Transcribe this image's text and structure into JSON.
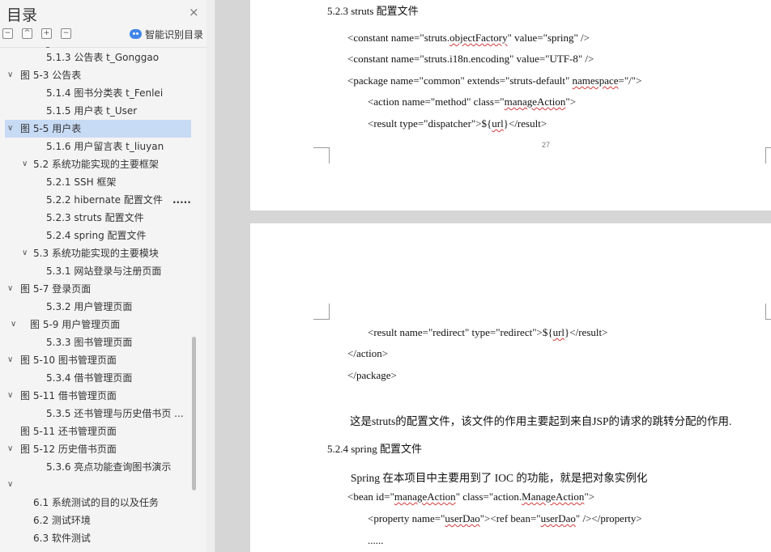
{
  "nav": {
    "title": "目录",
    "close_icon": "×",
    "toolbar": {
      "collapse_all": "−",
      "expand_all": "^",
      "expand_level": "+",
      "collapse_level": "−"
    },
    "ai_label": "智能识别目录",
    "items": [
      {
        "label": "5.1.3 公告表 t_Gonggao",
        "level": 2,
        "chevron": ""
      },
      {
        "label": "图  5-3  公告表",
        "level": 0,
        "chevron": "∨"
      },
      {
        "label": "5.1.4 图书分类表 t_Fenlei",
        "level": 2,
        "chevron": ""
      },
      {
        "label": "5.1.5 用户表 t_User",
        "level": 2,
        "chevron": ""
      },
      {
        "label": "图  5-5  用户表",
        "level": 0,
        "chevron": "∨",
        "selected": true
      },
      {
        "label": "5.1.6 用户留言表 t_liuyan",
        "level": 2,
        "chevron": ""
      },
      {
        "label": "5.2 系统功能实现的主要框架",
        "level": 1,
        "chevron": "∨"
      },
      {
        "label": "5.2.1 SSH 框架",
        "level": 2,
        "chevron": ""
      },
      {
        "label": "5.2.2 hibernate 配置文件",
        "level": 2,
        "chevron": "",
        "trail": "....."
      },
      {
        "label": "5.2.3 struts 配置文件",
        "level": 2,
        "chevron": ""
      },
      {
        "label": "5.2.4 spring 配置文件",
        "level": 2,
        "chevron": ""
      },
      {
        "label": "5.3 系统功能实现的主要模块",
        "level": 1,
        "chevron": "∨"
      },
      {
        "label": "5.3.1  网站登录与注册页面",
        "level": 2,
        "chevron": ""
      },
      {
        "label": "图  5-7  登录页面",
        "level": 0,
        "chevron": "∨"
      },
      {
        "label": "5.3.2  用户管理页面",
        "level": 2,
        "chevron": ""
      },
      {
        "label": "图 5-9  用户管理页面",
        "level": 0.6,
        "chevron": "∨"
      },
      {
        "label": "5.3.3  图书管理页面",
        "level": 2,
        "chevron": ""
      },
      {
        "label": "图 5-10  图书管理页面",
        "level": 0,
        "chevron": "∨"
      },
      {
        "label": "5.3.4 借书管理页面",
        "level": 2,
        "chevron": ""
      },
      {
        "label": "图 5-11  借书管理页面",
        "level": 0,
        "chevron": "∨"
      },
      {
        "label": "5.3.5  还书管理与历史借书页 ...",
        "level": 2,
        "chevron": ""
      },
      {
        "label": "图 5-11  还书管理页面",
        "level": 0,
        "chevron": ""
      },
      {
        "label": "图 5-12  历史借书页面",
        "level": 0,
        "chevron": "∨"
      },
      {
        "label": "5.3.6 亮点功能查询图书演示",
        "level": 2,
        "chevron": ""
      },
      {
        "label": "",
        "level": 0,
        "chevron": "∨"
      },
      {
        "label": "6.1  系统测试的目的以及任务",
        "level": 1.5,
        "chevron": ""
      },
      {
        "label": "6.2  测试环境",
        "level": 1.5,
        "chevron": ""
      },
      {
        "label": "6.3  软件测试",
        "level": 1.5,
        "chevron": ""
      }
    ]
  },
  "doc": {
    "page1": {
      "heading": "5.2.3 struts 配置文件",
      "page_number": "27",
      "lines": [
        [
          {
            "t": "<constant name=\"struts."
          },
          {
            "t": "objectFactory",
            "w": true
          },
          {
            "t": "\" value=\"spring\" />"
          }
        ],
        [
          {
            "t": "<constant name=\"struts.i18n.encoding\" value=\"UTF-8\" />"
          }
        ],
        [
          {
            "t": "<package name=\"common\" extends=\"struts-default\" "
          },
          {
            "t": "namespace",
            "w": true
          },
          {
            "t": "=\"/\">"
          }
        ],
        [
          {
            "t": "<action name=\"method\"    class=\""
          },
          {
            "t": "manageAction",
            "w": true
          },
          {
            "t": "\">"
          }
        ],
        [
          {
            "t": "<result type=\"dispatcher\">${"
          },
          {
            "t": "url",
            "w": true
          },
          {
            "t": "}</result>"
          }
        ]
      ]
    },
    "page2": {
      "lines": [
        [
          {
            "t": "<result name=\"redirect\" type=\"redirect\">${"
          },
          {
            "t": "url",
            "w": true
          },
          {
            "t": "}</result>"
          }
        ],
        [
          {
            "t": "</action>"
          }
        ],
        [
          {
            "t": "</package>"
          }
        ]
      ],
      "para1": "这是struts的配置文件，该文件的作用主要起到来自JSP的请求的跳转分配的作用.",
      "heading2": "5.2.4 spring 配置文件",
      "para2": "Spring  在本项目中主要用到了 IOC 的功能，就是把对象实例化",
      "lines2": [
        [
          {
            "t": "<bean id=\""
          },
          {
            "t": "manageAction",
            "w": true
          },
          {
            "t": "\"     class=\"action."
          },
          {
            "t": "ManageAction",
            "w": true
          },
          {
            "t": "\">"
          }
        ],
        [
          {
            "t": "<property name=\""
          },
          {
            "t": "userDao",
            "w": true
          },
          {
            "t": "\"><ref bean=\""
          },
          {
            "t": "userDao",
            "w": true
          },
          {
            "t": "\" /></property>"
          }
        ],
        [
          {
            "t": "......"
          }
        ]
      ]
    }
  }
}
